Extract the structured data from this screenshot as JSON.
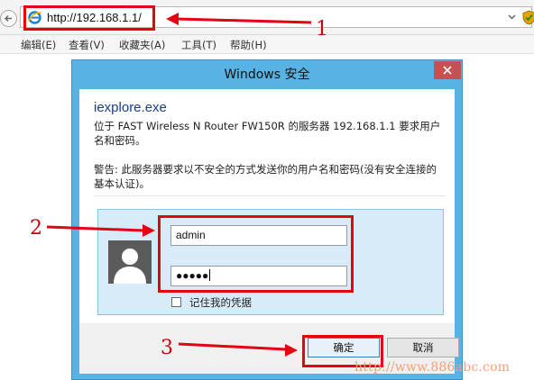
{
  "browser": {
    "url": "http://192.168.1.1/",
    "menu": [
      "编辑(E)",
      "查看(V)",
      "收藏夹(A)",
      "工具(T)",
      "帮助(H)"
    ]
  },
  "dialog": {
    "title": "Windows 安全",
    "app_name": "iexplore.exe",
    "message": "位于 FAST Wireless N Router FW150R 的服务器 192.168.1.1 要求用户名和密码。",
    "warning": "警告: 此服务器要求以不安全的方式发送你的用户名和密码(没有安全连接的基本认证)。",
    "username_value": "admin",
    "password_value": "●●●●●",
    "remember_label": "记住我的凭据",
    "remember_checked": false,
    "ok_label": "确定",
    "cancel_label": "取消"
  },
  "annotations": {
    "step1": "1",
    "step2": "2",
    "step3": "3",
    "color": "#e50012"
  },
  "watermark": "http://www.886abc.com",
  "icons": [
    "back-arrow-icon",
    "ie-logo-icon",
    "chevron-down-icon",
    "shield-icon",
    "close-icon",
    "user-avatar-icon"
  ]
}
